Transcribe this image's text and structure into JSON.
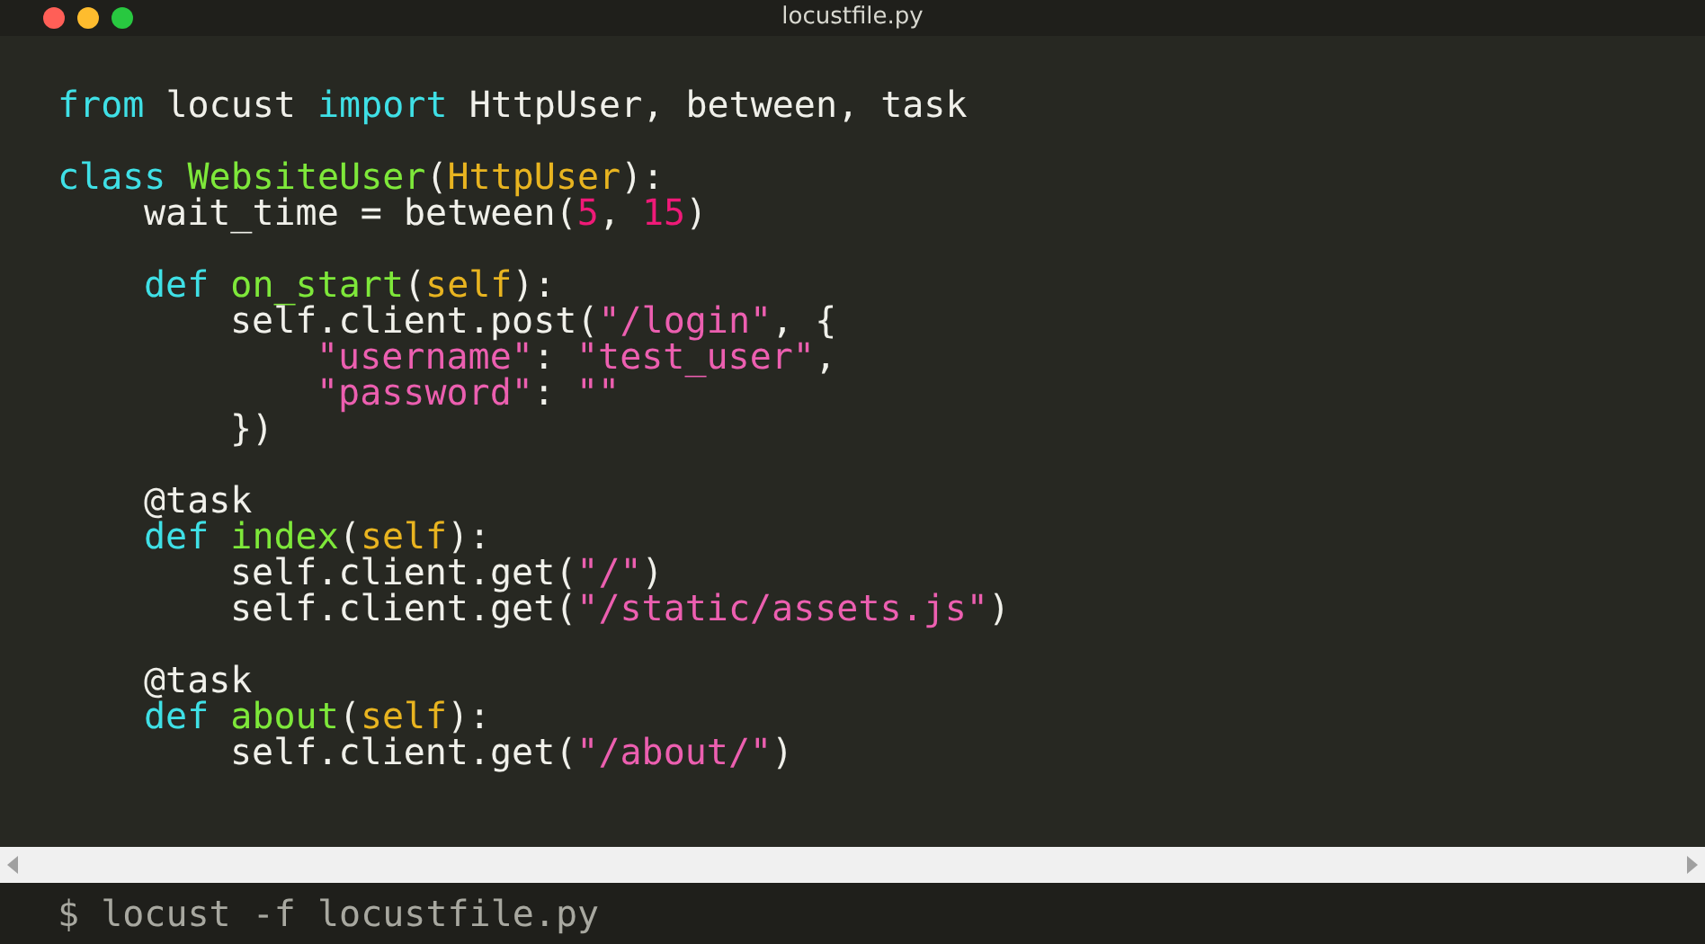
{
  "window": {
    "title": "locustfile.py"
  },
  "code_lines": [
    {
      "tokens": [
        {
          "text": "from ",
          "kind": "keyword"
        },
        {
          "text": "locust ",
          "kind": "plain"
        },
        {
          "text": "import ",
          "kind": "keyword"
        },
        {
          "text": "HttpUser, between, task",
          "kind": "plain"
        }
      ]
    },
    {
      "gap_before": true,
      "tokens": [
        {
          "text": "class ",
          "kind": "keyword"
        },
        {
          "text": "WebsiteUser",
          "kind": "name"
        },
        {
          "text": "(",
          "kind": "plain"
        },
        {
          "text": "HttpUser",
          "kind": "param"
        },
        {
          "text": "):",
          "kind": "plain"
        }
      ],
      "children": [
        {
          "tokens": [
            {
              "text": "wait_time = between(",
              "kind": "plain"
            },
            {
              "text": "5",
              "kind": "number"
            },
            {
              "text": ", ",
              "kind": "plain"
            },
            {
              "text": "15",
              "kind": "number"
            },
            {
              "text": ")",
              "kind": "plain"
            }
          ]
        },
        {
          "gap_before": true,
          "tokens": [
            {
              "text": "def ",
              "kind": "keyword"
            },
            {
              "text": "on_start",
              "kind": "name"
            },
            {
              "text": "(",
              "kind": "plain"
            },
            {
              "text": "self",
              "kind": "param"
            },
            {
              "text": "):",
              "kind": "plain"
            }
          ],
          "children": [
            {
              "tokens": [
                {
                  "text": "self.client.post(",
                  "kind": "plain"
                },
                {
                  "text": "\"/login\"",
                  "kind": "string"
                },
                {
                  "text": ", {",
                  "kind": "plain"
                }
              ],
              "children": [
                {
                  "tokens": [
                    {
                      "text": "\"username\"",
                      "kind": "string"
                    },
                    {
                      "text": ": ",
                      "kind": "plain"
                    },
                    {
                      "text": "\"test_user\"",
                      "kind": "string"
                    },
                    {
                      "text": ",",
                      "kind": "plain"
                    }
                  ]
                },
                {
                  "tokens": [
                    {
                      "text": "\"password\"",
                      "kind": "string"
                    },
                    {
                      "text": ": ",
                      "kind": "plain"
                    },
                    {
                      "text": "\"\"",
                      "kind": "string"
                    }
                  ]
                }
              ]
            },
            {
              "tokens": [
                {
                  "text": "})",
                  "kind": "plain"
                }
              ]
            }
          ]
        },
        {
          "gap_before": true,
          "tokens": [
            {
              "text": "@task",
              "kind": "plain"
            }
          ]
        },
        {
          "tokens": [
            {
              "text": "def ",
              "kind": "keyword"
            },
            {
              "text": "index",
              "kind": "name"
            },
            {
              "text": "(",
              "kind": "plain"
            },
            {
              "text": "self",
              "kind": "param"
            },
            {
              "text": "):",
              "kind": "plain"
            }
          ],
          "children": [
            {
              "tokens": [
                {
                  "text": "self.client.get(",
                  "kind": "plain"
                },
                {
                  "text": "\"/\"",
                  "kind": "string"
                },
                {
                  "text": ")",
                  "kind": "plain"
                }
              ]
            },
            {
              "tokens": [
                {
                  "text": "self.client.get(",
                  "kind": "plain"
                },
                {
                  "text": "\"/static/assets.js\"",
                  "kind": "string"
                },
                {
                  "text": ")",
                  "kind": "plain"
                }
              ]
            }
          ]
        },
        {
          "gap_before": true,
          "tokens": [
            {
              "text": "@task",
              "kind": "plain"
            }
          ]
        },
        {
          "tokens": [
            {
              "text": "def ",
              "kind": "keyword"
            },
            {
              "text": "about",
              "kind": "name"
            },
            {
              "text": "(",
              "kind": "plain"
            },
            {
              "text": "self",
              "kind": "param"
            },
            {
              "text": "):",
              "kind": "plain"
            }
          ],
          "children": [
            {
              "tokens": [
                {
                  "text": "self.client.get(",
                  "kind": "plain"
                },
                {
                  "text": "\"/about/\"",
                  "kind": "string"
                },
                {
                  "text": ")",
                  "kind": "plain"
                }
              ]
            }
          ]
        }
      ]
    }
  ],
  "terminal": {
    "command": "$ locust -f locustfile.py"
  }
}
